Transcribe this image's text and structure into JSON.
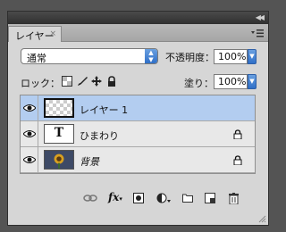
{
  "panel": {
    "tab_label": "レイヤー",
    "tab_close": "×"
  },
  "blend": {
    "mode": "通常",
    "opacity_label": "不透明度：",
    "opacity_value": "100%"
  },
  "lock": {
    "label": "ロック：",
    "fill_label": "塗り：",
    "fill_value": "100%"
  },
  "layers": [
    {
      "name": "レイヤー 1",
      "selected": true,
      "type": "raster",
      "locked": false
    },
    {
      "name": "ひまわり",
      "selected": false,
      "type": "text",
      "locked": true,
      "thumb_text": "T"
    },
    {
      "name": "背景",
      "selected": false,
      "type": "background",
      "locked": true
    }
  ],
  "colors": {
    "selected_row": "#b3cdf0",
    "accent": "#2f6fc8"
  },
  "bottom_icons": [
    "link-icon",
    "fx-icon",
    "mask-icon",
    "adjustment-icon",
    "group-folder-icon",
    "new-layer-icon",
    "trash-icon"
  ]
}
